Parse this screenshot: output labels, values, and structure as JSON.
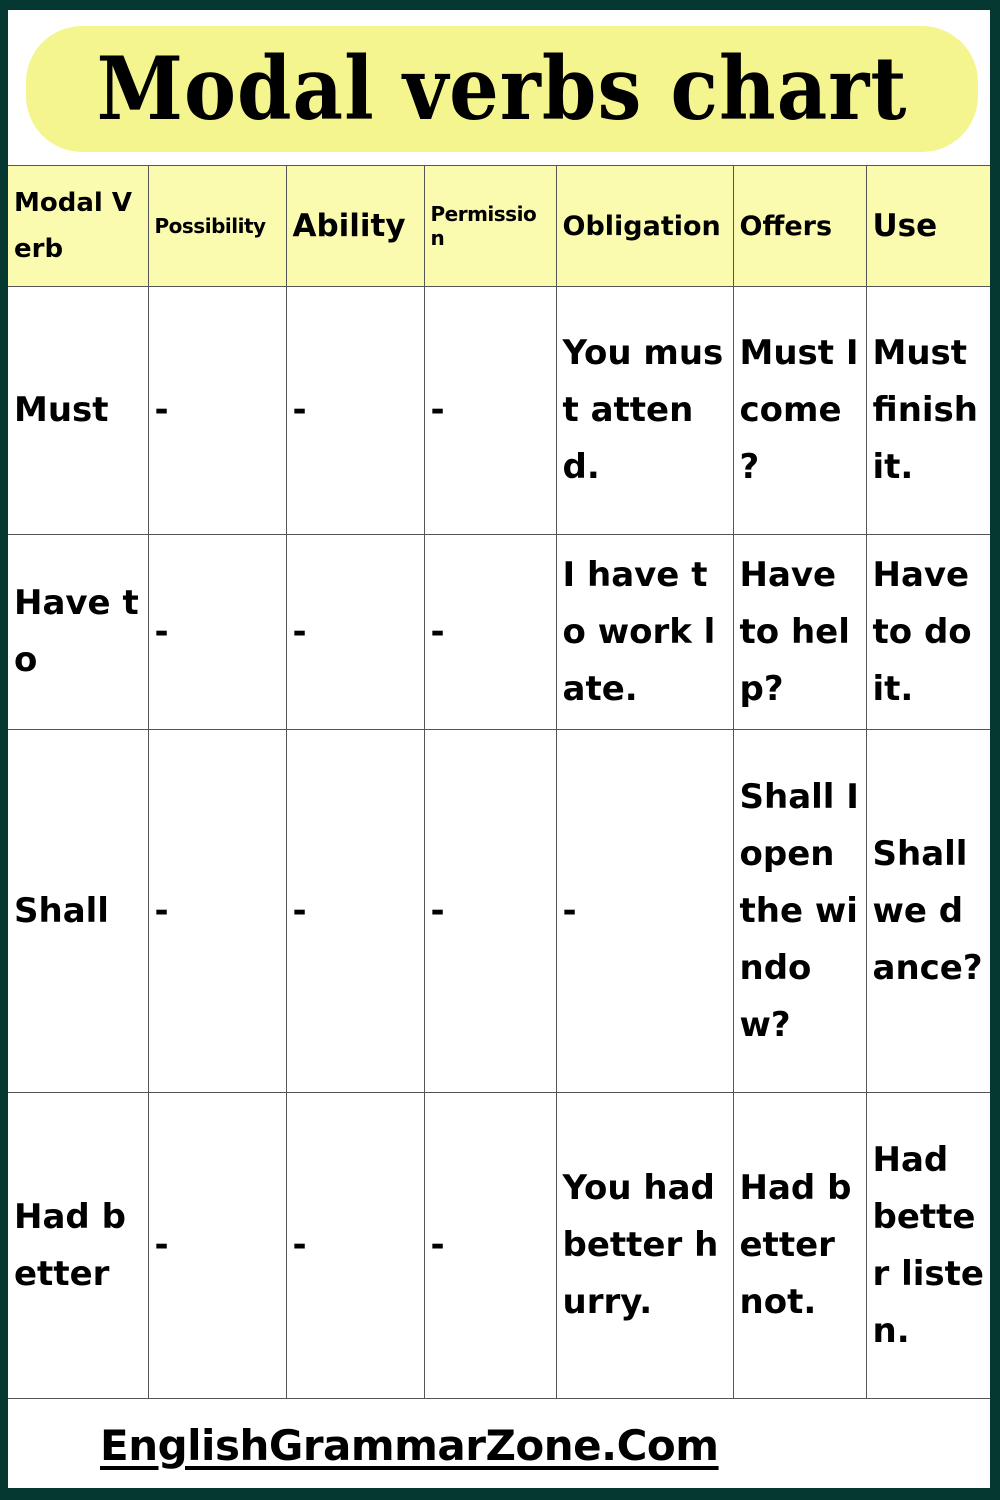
{
  "title": "Modal verbs chart",
  "table": {
    "headers": [
      "Modal Verb",
      "Possibility",
      "Ability",
      "Permission",
      "Obligation",
      "Offers",
      "Use"
    ],
    "rows": [
      {
        "modal": "Must",
        "possibility": "-",
        "ability": "-",
        "permission": "-",
        "obligation": "You must attend.",
        "offers": "Must I come ?",
        "use": "Must finish it."
      },
      {
        "modal": "Have to",
        "possibility": "-",
        "ability": "-",
        "permission": "-",
        "obligation": "I have to work late.",
        "offers": "Have to help?",
        "use": "Have to do it."
      },
      {
        "modal": "Shall",
        "possibility": "-",
        "ability": "-",
        "permission": "-",
        "obligation": "-",
        "offers": "Shall I open the window?",
        "use": "Shall we dance?"
      },
      {
        "modal": "Had better",
        "possibility": "-",
        "ability": "-",
        "permission": "-",
        "obligation": "You had better hurry.",
        "offers": "Had better not.",
        "use": "Had better listen."
      }
    ]
  },
  "footer": {
    "site": "EnglishGrammarZone.Com"
  },
  "colors": {
    "frame": "#053830",
    "title_bg": "#f5f590",
    "header_bg": "#fbfbb0"
  }
}
